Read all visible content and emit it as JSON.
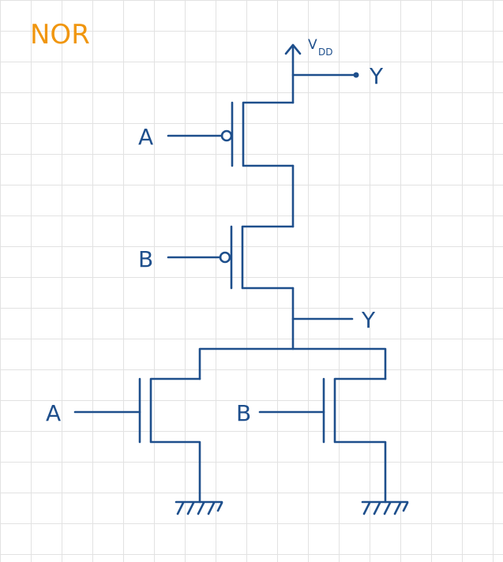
{
  "title": "NOR",
  "labels": {
    "vdd_main": "V",
    "vdd_sub": "DD",
    "output_top": "Y",
    "output_mid": "Y",
    "pmos_a": "A",
    "pmos_b": "B",
    "nmos_a": "A",
    "nmos_b": "B"
  },
  "colors": {
    "wire": "#1e4f8c",
    "title": "#f0960f",
    "grid": "#e2e2e2"
  }
}
